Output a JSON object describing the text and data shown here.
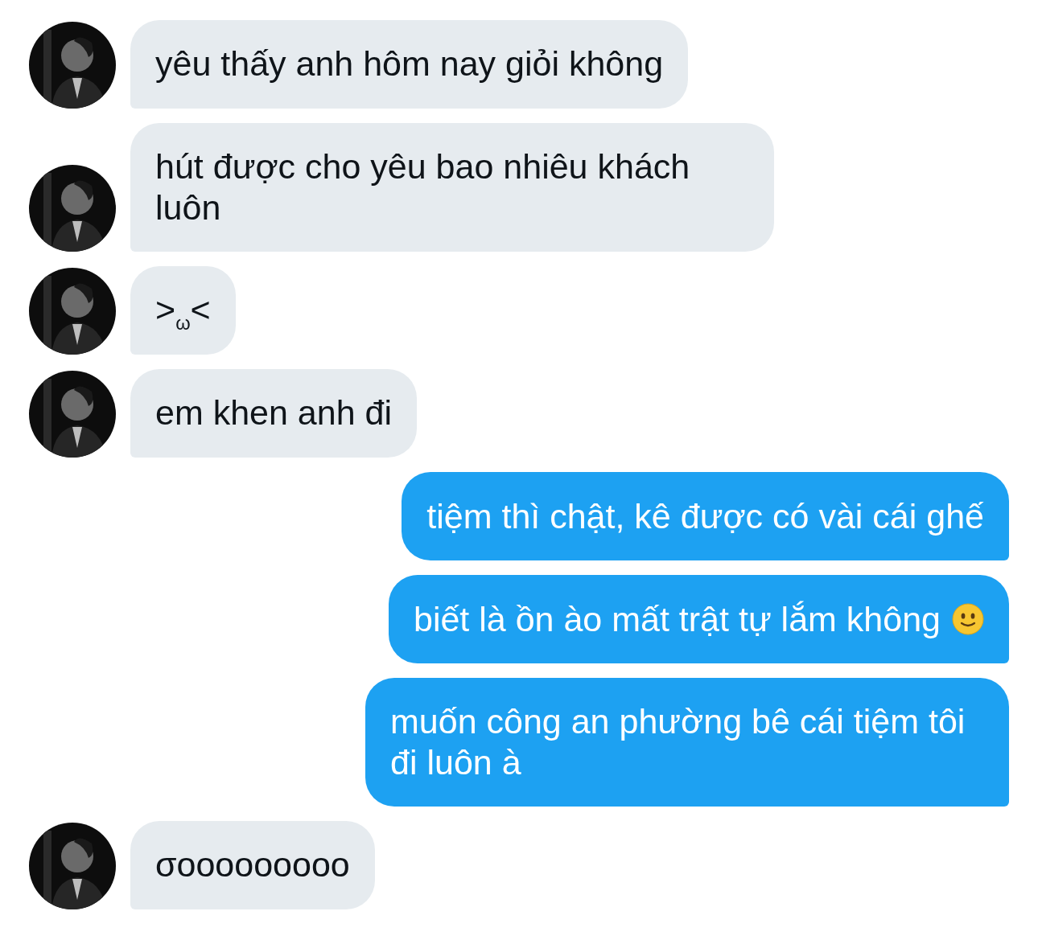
{
  "messages": [
    {
      "kind": "incoming",
      "text": "yêu thấy anh hôm nay giỏi không"
    },
    {
      "kind": "incoming",
      "text": "hút được cho yêu bao nhiêu khách luôn"
    },
    {
      "kind": "incoming",
      "text": ">$_{ω}$<"
    },
    {
      "kind": "incoming",
      "text": "em khen anh đi"
    },
    {
      "kind": "outgoing",
      "text": "tiệm thì chật, kê được có vài cái ghế"
    },
    {
      "kind": "outgoing",
      "text": "biết là ồn ào mất trật tự lắm không",
      "has_emoji": true
    },
    {
      "kind": "outgoing",
      "text": "muốn công an phường bê cái tiệm tôi đi luôn à"
    },
    {
      "kind": "incoming",
      "text": "σooooooooo"
    }
  ]
}
